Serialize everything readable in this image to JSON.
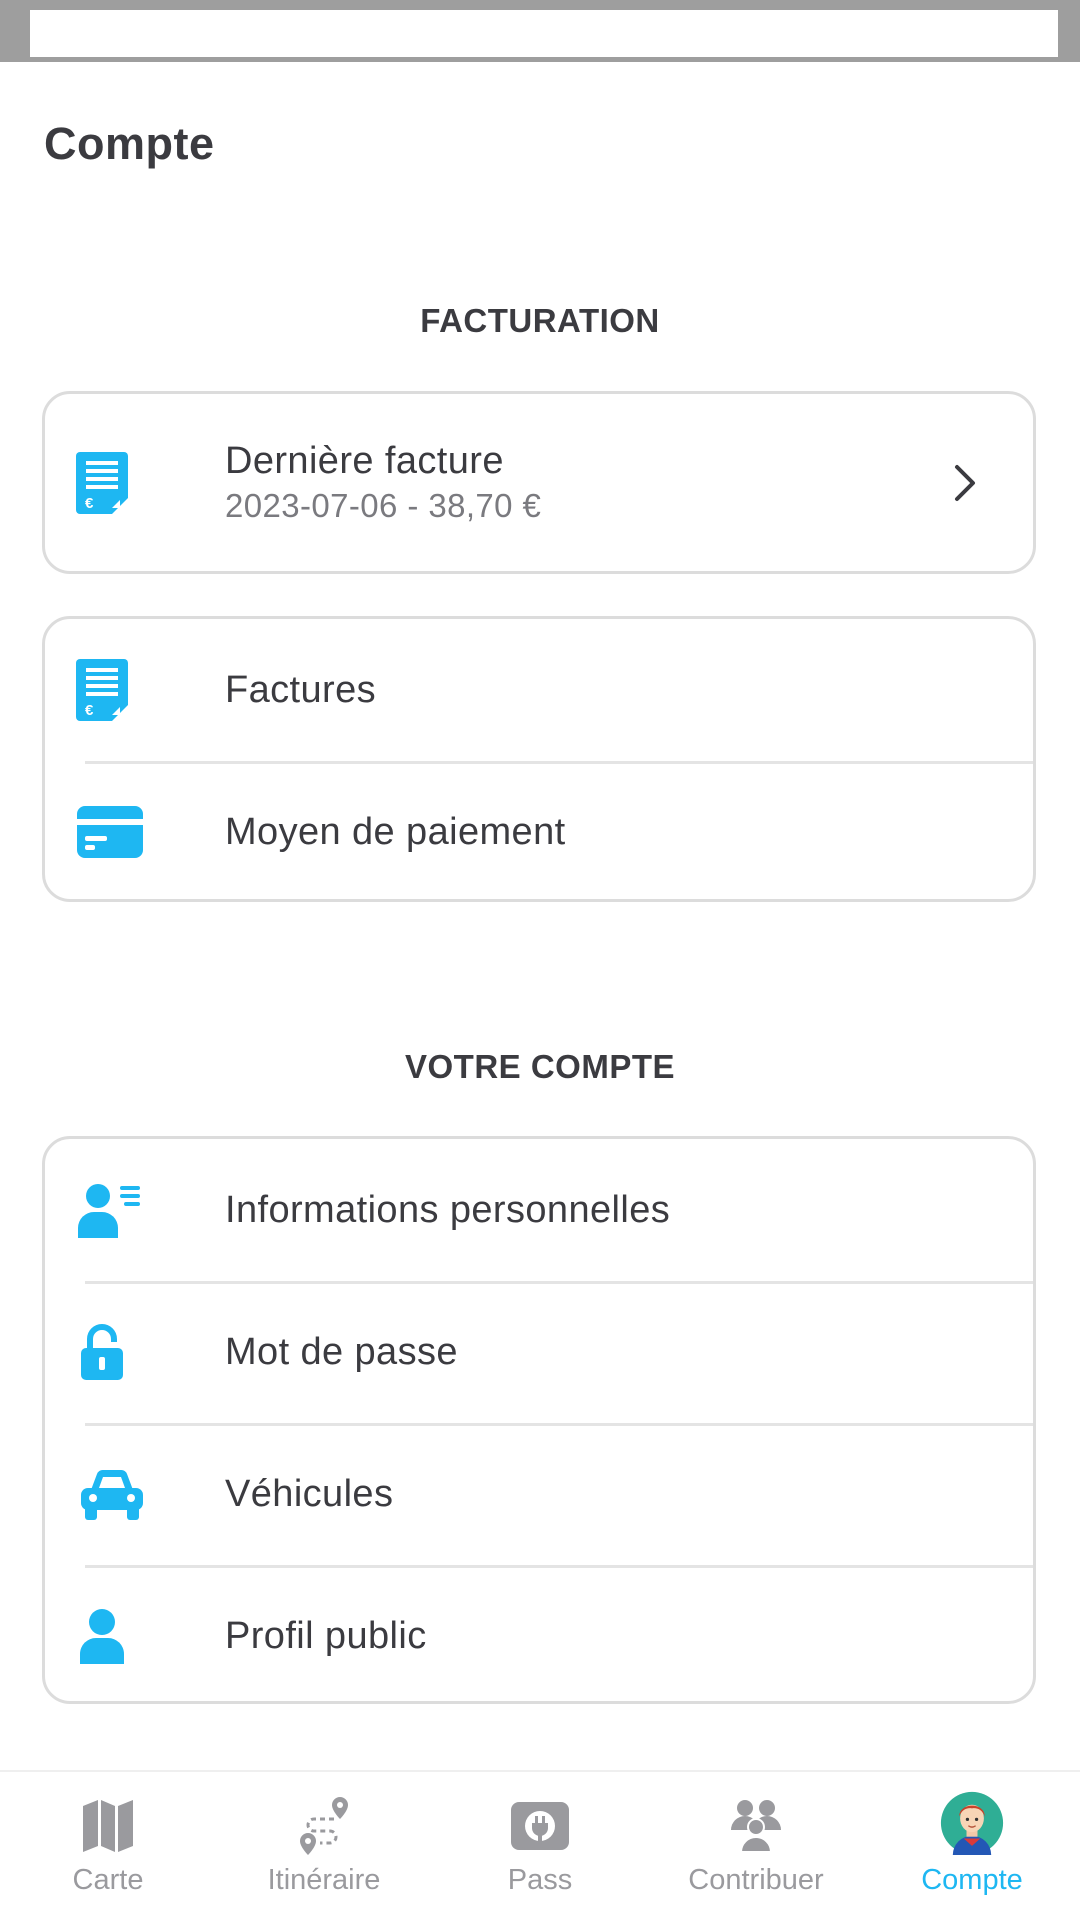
{
  "page": {
    "title": "Compte"
  },
  "billing": {
    "section_title": "FACTURATION",
    "last_invoice": {
      "label": "Dernière facture",
      "detail": "2023-07-06 - 38,70 €",
      "icon": "invoice-icon"
    },
    "items": [
      {
        "label": "Factures",
        "icon": "invoice-icon"
      },
      {
        "label": "Moyen de paiement",
        "icon": "credit-card-icon"
      }
    ]
  },
  "account": {
    "section_title": "VOTRE COMPTE",
    "items": [
      {
        "label": "Informations personnelles",
        "icon": "id-card-icon"
      },
      {
        "label": "Mot de passe",
        "icon": "lock-icon"
      },
      {
        "label": "Véhicules",
        "icon": "car-icon"
      },
      {
        "label": "Profil public",
        "icon": "person-icon"
      }
    ]
  },
  "nav": {
    "items": [
      {
        "label": "Carte",
        "icon": "map-icon"
      },
      {
        "label": "Itinéraire",
        "icon": "route-icon"
      },
      {
        "label": "Pass",
        "icon": "charging-plug-icon"
      },
      {
        "label": "Contribuer",
        "icon": "community-icon"
      },
      {
        "label": "Compte",
        "icon": "avatar-icon",
        "active": true
      }
    ]
  },
  "colors": {
    "accent": "#1eb7f2",
    "text": "#3b3b40",
    "muted": "#9a9a9e",
    "border": "#dcdcdc"
  }
}
